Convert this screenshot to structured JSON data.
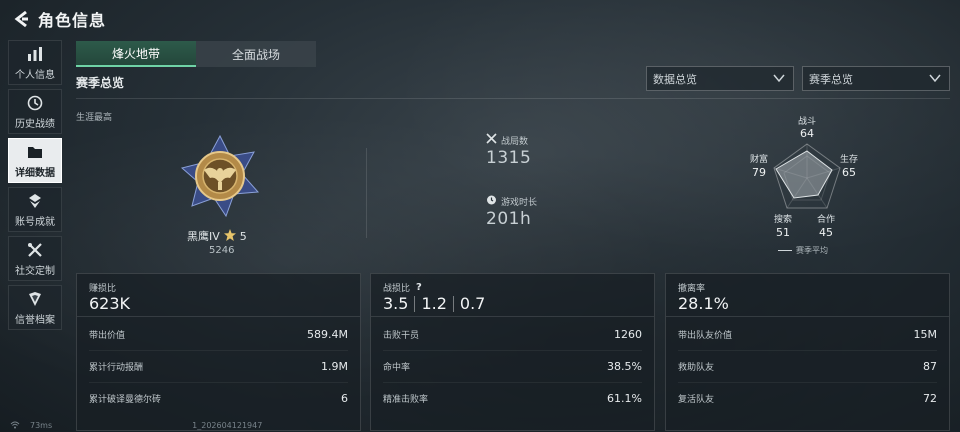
{
  "header": {
    "title": "角色信息"
  },
  "sidebar": {
    "items": [
      {
        "label": "个人信息",
        "icon": "bar-chart-icon"
      },
      {
        "label": "历史战绩",
        "icon": "history-icon"
      },
      {
        "label": "详细数据",
        "icon": "folder-icon",
        "active": true
      },
      {
        "label": "账号成就",
        "icon": "medal-icon"
      },
      {
        "label": "社交定制",
        "icon": "tools-icon"
      },
      {
        "label": "信誉档案",
        "icon": "shield-icon"
      }
    ]
  },
  "tabs": [
    {
      "label": "烽火地带",
      "active": true
    },
    {
      "label": "全面战场",
      "active": false
    }
  ],
  "section_title": "赛季总览",
  "dropdowns": [
    {
      "value": "数据总览"
    },
    {
      "value": "赛季总览"
    }
  ],
  "career": {
    "label": "生涯最高",
    "rank_name": "黑鹰IV",
    "stars": "5",
    "points": "5246"
  },
  "stats": {
    "battles_label": "战局数",
    "battles_value": "1315",
    "playtime_label": "游戏时长",
    "playtime_value": "201h"
  },
  "radar": {
    "labels": {
      "combat": "战斗",
      "survival": "生存",
      "cooperation": "合作",
      "search": "搜索",
      "wealth": "财富"
    },
    "values": {
      "combat": "64",
      "survival": "65",
      "cooperation": "45",
      "search": "51",
      "wealth": "79"
    },
    "legend": "赛季平均"
  },
  "cards": {
    "profit": {
      "title": "赚损比",
      "value": "623K",
      "rows": [
        {
          "label": "带出价值",
          "value": "589.4M"
        },
        {
          "label": "累计行动报酬",
          "value": "1.9M"
        },
        {
          "label": "累计破译曼德尔砖",
          "value": "6"
        }
      ]
    },
    "kd": {
      "title": "战损比",
      "help": "?",
      "values": [
        "3.5",
        "1.2",
        "0.7"
      ],
      "rows": [
        {
          "label": "击败干员",
          "value": "1260"
        },
        {
          "label": "命中率",
          "value": "38.5%"
        },
        {
          "label": "精准击败率",
          "value": "61.1%"
        }
      ]
    },
    "extract": {
      "title": "撤离率",
      "value": "28.1%",
      "rows": [
        {
          "label": "带出队友价值",
          "value": "15M"
        },
        {
          "label": "救助队友",
          "value": "87"
        },
        {
          "label": "复活队友",
          "value": "72"
        }
      ]
    }
  },
  "footer": {
    "ping": "73ms",
    "id": "1_202604121947"
  }
}
